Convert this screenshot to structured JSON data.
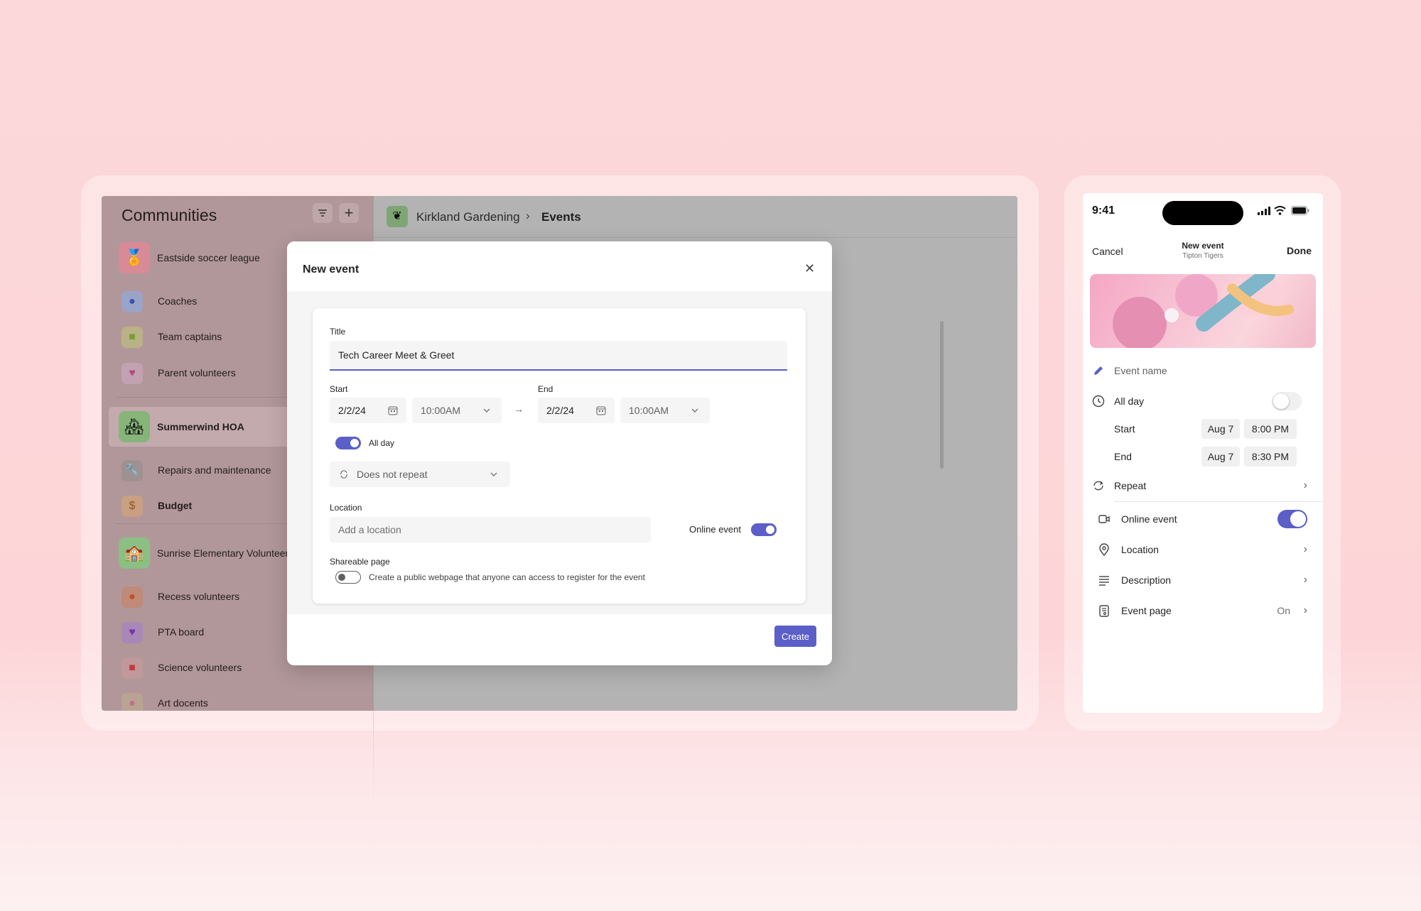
{
  "desktop": {
    "sidebar": {
      "title": "Communities",
      "filter_icon": "filter-icon",
      "add_icon": "+",
      "items": [
        {
          "label": "Eastside soccer league",
          "icon": "medal-icon",
          "glyph": "🏅",
          "group": true
        },
        {
          "label": "Coaches",
          "icon": "whistle-icon",
          "glyph": "●"
        },
        {
          "label": "Team captains",
          "icon": "captain-icon",
          "glyph": "■"
        },
        {
          "label": "Parent volunteers",
          "icon": "heart-hands-icon",
          "glyph": "♥"
        },
        {
          "label": "Summerwind HOA",
          "icon": "houses-icon",
          "glyph": "🏘",
          "group": true,
          "selected": true
        },
        {
          "label": "Repairs and maintenance",
          "icon": "wrench-icon",
          "glyph": "🔧"
        },
        {
          "label": "Budget",
          "icon": "money-bag-icon",
          "glyph": "$"
        },
        {
          "label": "Sunrise Elementary Volunteers",
          "icon": "school-icon",
          "glyph": "🏫",
          "group": true
        },
        {
          "label": "Recess volunteers",
          "icon": "basketball-icon",
          "glyph": "●"
        },
        {
          "label": "PTA board",
          "icon": "purple-heart-icon",
          "glyph": "♥"
        },
        {
          "label": "Science volunteers",
          "icon": "magnet-icon",
          "glyph": "■"
        },
        {
          "label": "Art docents",
          "icon": "palette-icon",
          "glyph": "●"
        }
      ]
    },
    "header": {
      "community": "Kirkland Gardening",
      "separator": "›",
      "page": "Events"
    }
  },
  "dialog": {
    "title": "New event",
    "close": "✕",
    "title_label": "Title",
    "title_value": "Tech Career Meet & Greet",
    "start_label": "Start",
    "start_date": "2/2/24",
    "start_time": "10:00AM",
    "arrow": "→",
    "end_label": "End",
    "end_date": "2/2/24",
    "end_time": "10:00AM",
    "all_day_label": "All day",
    "all_day_on": true,
    "repeat_value": "Does not repeat",
    "location_label": "Location",
    "location_placeholder": "Add a location",
    "online_label": "Online event",
    "online_on": true,
    "shareable_label": "Shareable page",
    "shareable_text": "Create a public webpage that anyone can access to register for the event",
    "shareable_on": false,
    "create_label": "Create"
  },
  "phone": {
    "time": "9:41",
    "cancel": "Cancel",
    "title": "New event",
    "subtitle": "Tipton Tigers",
    "done": "Done",
    "event_name_placeholder": "Event name",
    "all_day_label": "All day",
    "start_label": "Start",
    "start_date": "Aug 7",
    "start_time": "8:00 PM",
    "end_label": "End",
    "end_date": "Aug 7",
    "end_time": "8:30 PM",
    "repeat_label": "Repeat",
    "online_label": "Online event",
    "location_label": "Location",
    "description_label": "Description",
    "event_page_label": "Event page",
    "event_page_value": "On",
    "chevron": "›"
  },
  "colors": {
    "accent": "#5b5fc7",
    "background": "#fdd5d8"
  }
}
